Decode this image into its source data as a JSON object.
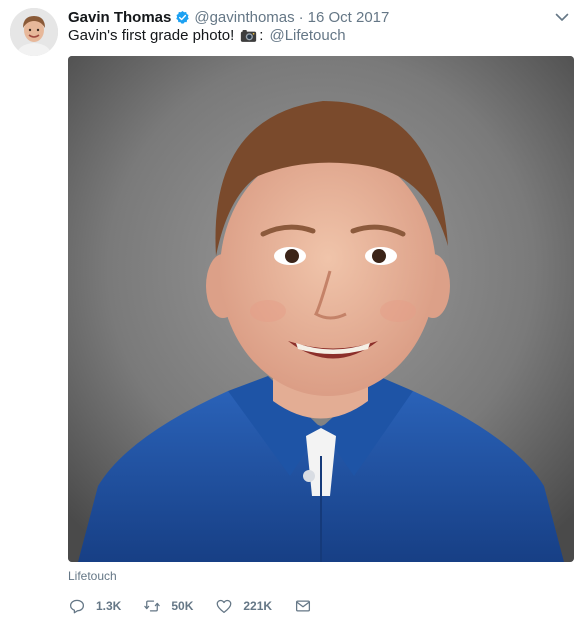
{
  "tweet": {
    "display_name": "Gavin Thomas",
    "handle": "@gavinthomas",
    "separator": "·",
    "date": "16 Oct 2017",
    "text": "Gavin's first grade photo!",
    "emoji_icon": "camera-emoji",
    "text_after_emoji": ":",
    "mention": "@Lifetouch",
    "media_credit": "Lifetouch"
  },
  "actions": {
    "reply_count": "1.3K",
    "retweet_count": "50K",
    "like_count": "221K"
  },
  "icons": {
    "verified": "verified-badge-icon",
    "caret": "chevron-down-icon",
    "reply": "reply-icon",
    "retweet": "retweet-icon",
    "like": "heart-icon",
    "dm": "envelope-icon"
  },
  "colors": {
    "text_primary": "#14171a",
    "text_secondary": "#657786",
    "verified_blue": "#1da1f2",
    "shirt_blue": "#1c4f9c",
    "backdrop_gray": "#7d7d7d"
  }
}
